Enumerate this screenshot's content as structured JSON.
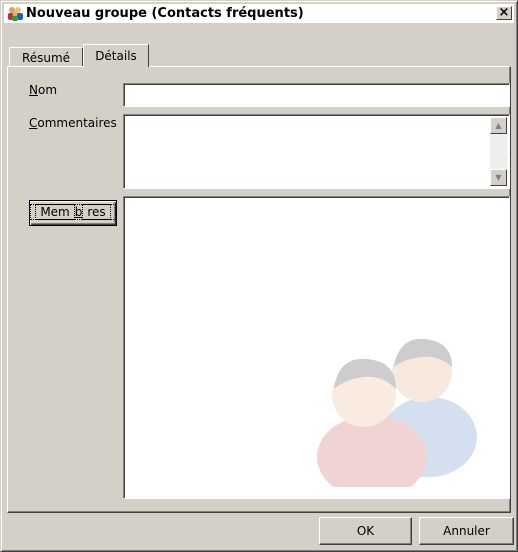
{
  "window": {
    "title": "Nouveau groupe (Contacts fréquents)",
    "close_label": "×"
  },
  "tabs": [
    {
      "label": "Résumé",
      "selected": false
    },
    {
      "label": "Détails",
      "selected": true
    }
  ],
  "form": {
    "nom": {
      "label_accel": "N",
      "label_rest": "om",
      "value": ""
    },
    "commentaires": {
      "label_accel": "C",
      "label_rest": "ommentaires",
      "value": ""
    },
    "members_button": {
      "label_pre": "Mem",
      "label_accel": "b",
      "label_post": "res"
    }
  },
  "buttons": {
    "ok": "OK",
    "cancel": "Annuler"
  },
  "icons": {
    "title": "group-contacts-icon",
    "watermark": "two-people-icon"
  },
  "colors": {
    "dialog_bg": "#d4d0c8",
    "field_bg": "#ffffff",
    "person_red": "#c04040",
    "person_blue": "#4070c0"
  }
}
